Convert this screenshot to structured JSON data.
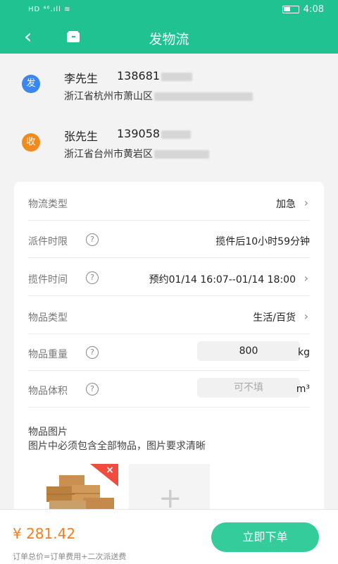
{
  "status": {
    "left": "HD ⁴⁶.ıll ≋",
    "time": "4:08"
  },
  "nav": {
    "back": "‹",
    "title": "发物流"
  },
  "sender": {
    "badge": "发",
    "name": "李先生",
    "phone": "138681",
    "address": "浙江省杭州市萧山区"
  },
  "receiver": {
    "badge": "收",
    "name": "张先生",
    "phone": "139058",
    "address": "浙江省台州市黄岩区"
  },
  "form": {
    "logistics_type": {
      "label": "物流类型",
      "value": "加急"
    },
    "delivery_limit": {
      "label": "派件时限",
      "value": "揽件后10小时59分钟"
    },
    "pickup_time": {
      "label": "揽件时间",
      "value": "预约01/14 16:07--01/14 18:00"
    },
    "item_type": {
      "label": "物品类型",
      "value": "生活/百货"
    },
    "weight": {
      "label": "物品重量",
      "value": "800",
      "unit": "kg"
    },
    "volume": {
      "label": "物品体积",
      "placeholder": "可不填",
      "unit": "m³"
    }
  },
  "photo": {
    "title": "物品图片",
    "hint": "图片中必须包含全部物品，图片要求清晰",
    "add": "+"
  },
  "footer": {
    "price": "¥ 281.42",
    "note": "订单总价=订单费用+二次派送费",
    "button": "立即下单"
  },
  "icons": {
    "help": "?",
    "chevron": "›",
    "delete": "×"
  },
  "colors": {
    "primary": "#1fc290",
    "sender_badge": "#3b86f0",
    "receiver_badge": "#f08b1e",
    "price": "#ff7b1a"
  }
}
